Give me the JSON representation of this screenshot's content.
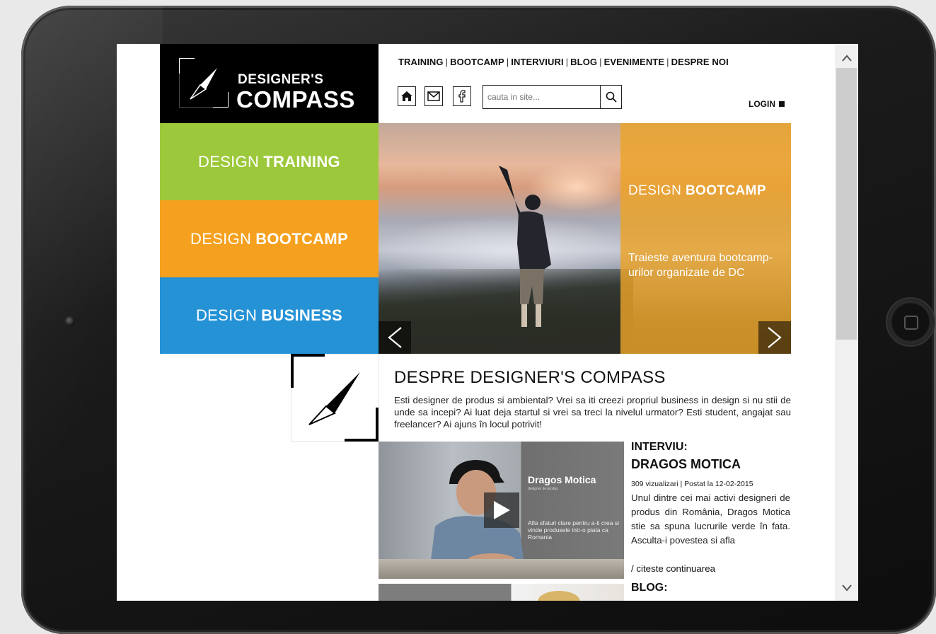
{
  "nav": {
    "items": [
      "TRAINING",
      "BOOTCAMP",
      "INTERVIURI",
      "BLOG",
      "EVENIMENTE",
      "DESPRE NOI"
    ],
    "separator": "|"
  },
  "logo": {
    "line1": "DESIGNER'S",
    "line2": "COMPASS"
  },
  "search": {
    "placeholder": "cauta in site..."
  },
  "login": {
    "label": "LOGIN"
  },
  "tiles": [
    {
      "prefix": "DESIGN",
      "bold": "TRAINING",
      "color": "#9cc83b"
    },
    {
      "prefix": "DESIGN",
      "bold": "BOOTCAMP",
      "color": "#f5a11f"
    },
    {
      "prefix": "DESIGN",
      "bold": "BUSINESS",
      "color": "#2592d6"
    }
  ],
  "hero": {
    "title_prefix": "DESIGN",
    "title_bold": "BOOTCAMP",
    "subtitle": "Traieste aventura bootcamp-urilor organizate de DC",
    "overlay_color": "#eca428"
  },
  "about": {
    "title": "DESPRE DESIGNER'S COMPASS",
    "text": "Esti designer de produs si ambiental? Vrei sa iti creezi propriul business in design si nu stii de unde sa incepi? Ai luat deja startul si vrei sa treci la nivelul urmator? Esti student, angajat sau freelancer? Ai ajuns în locul potrivit!"
  },
  "interview": {
    "label": "INTERVIU:",
    "name": "DRAGOS MOTICA",
    "meta": "309 vizualizari | Postat la 12-02-2015",
    "text": "Unul dintre cei mai activi designeri de produs din România, Dragos Motica stie sa spuna lucrurile verde în fata. Asculta-i povestea si afla",
    "more": "/ citeste continuarea",
    "video": {
      "name": "Dragos Motica",
      "role": "designer de produs",
      "desc": "Afla sfaturi clare pentru a-ti crea si vinde produsele intr-o piata ca Romania"
    }
  },
  "blog": {
    "label": "BLOG:"
  },
  "icons": [
    "home-icon",
    "mail-icon",
    "facebook-icon",
    "search-icon",
    "chevron-left-icon",
    "chevron-right-icon",
    "play-icon",
    "compass-icon"
  ]
}
